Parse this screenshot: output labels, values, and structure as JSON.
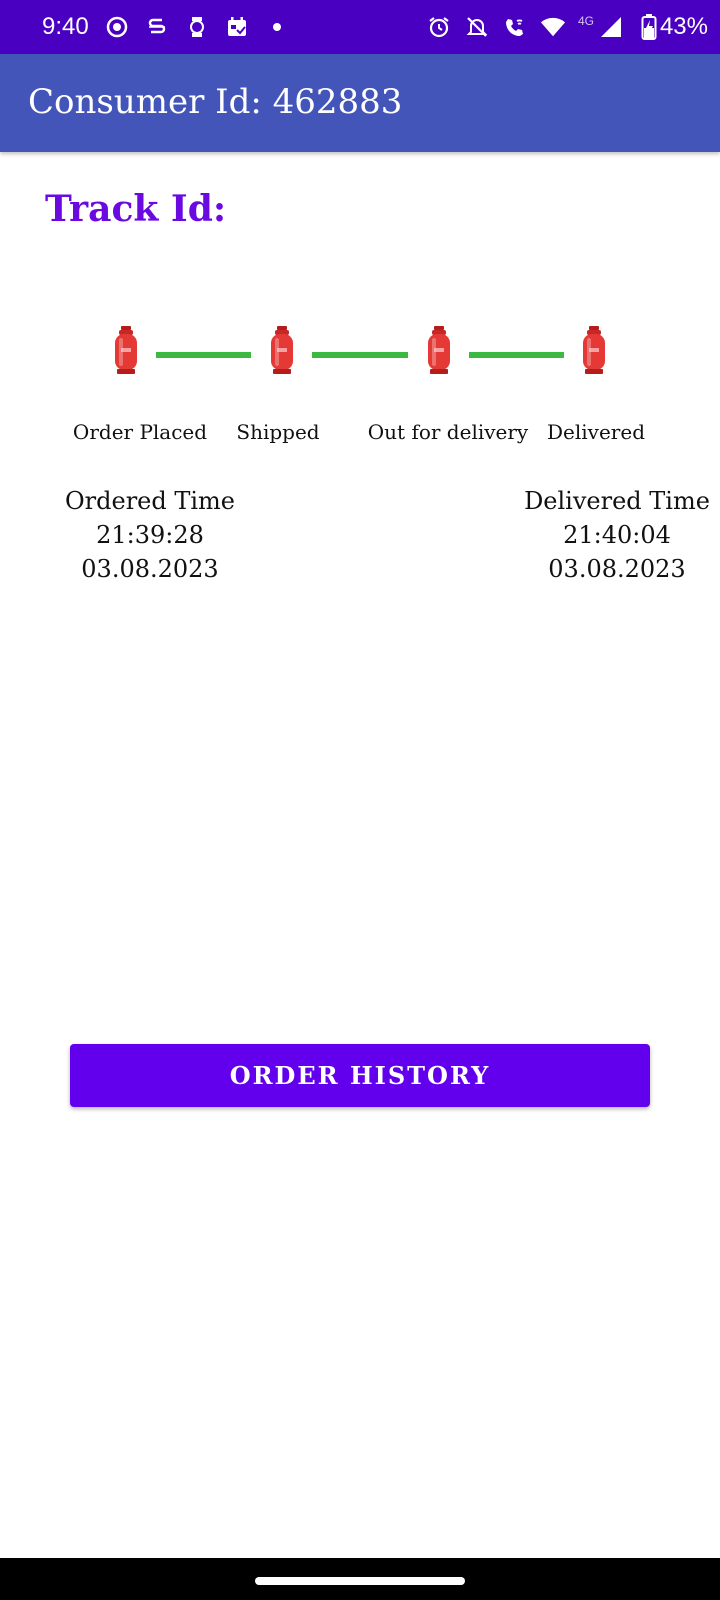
{
  "status_bar": {
    "time": "9:40",
    "battery": "43%",
    "network": "4G",
    "left_icons": [
      "screen-record-icon",
      "s-app-icon",
      "watch-icon",
      "calendar-icon",
      "notification-dot-icon"
    ],
    "right_icons": [
      "alarm-icon",
      "mute-icon",
      "wifi-calling-icon",
      "wifi-icon",
      "signal-icon",
      "battery-charging-icon"
    ]
  },
  "app_bar": {
    "title": "Consumer Id: 462883",
    "color": "#4355b9"
  },
  "track": {
    "label": "Track Id:",
    "color": "#6a0ae0"
  },
  "steps": [
    {
      "label": "Order Placed"
    },
    {
      "label": "Shipped"
    },
    {
      "label": "Out for delivery"
    },
    {
      "label": "Delivered"
    }
  ],
  "progress": {
    "completed_connectors": 3,
    "connector_color": "#3cb943",
    "icon": "gas-cylinder-icon",
    "icon_color": "#e53935"
  },
  "ordered": {
    "title": "Ordered Time",
    "time": "21:39:28",
    "date": "03.08.2023"
  },
  "delivered": {
    "title": "Delivered Time",
    "time": "21:40:04",
    "date": "03.08.2023"
  },
  "order_history_button": {
    "label": "ORDER HISTORY",
    "color": "#6200ee"
  }
}
